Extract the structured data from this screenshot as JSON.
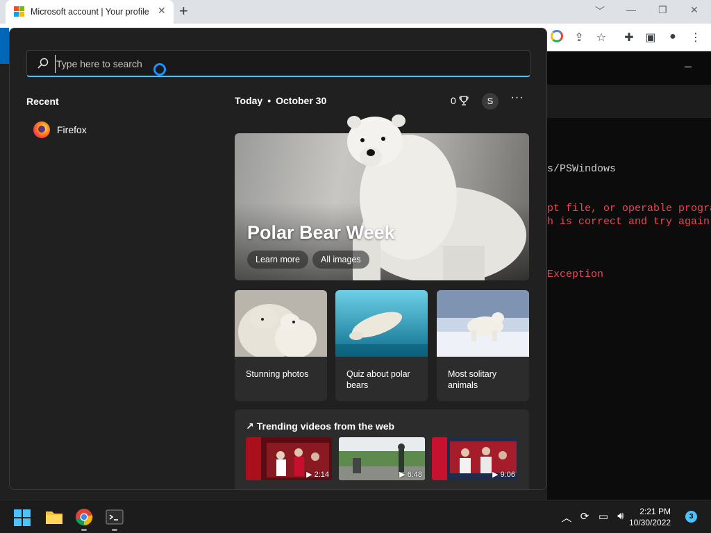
{
  "browser": {
    "tab_title": "Microsoft account | Your profile",
    "tab_close": "✕",
    "new_tab": "+"
  },
  "terminal": {
    "lines": [
      "s/PSWindows",
      "pt file, or operable progra",
      "h is correct and try again",
      "Exception"
    ]
  },
  "search": {
    "placeholder": "Type here to search",
    "value": ""
  },
  "recent": {
    "title": "Recent",
    "items": [
      {
        "label": "Firefox",
        "icon": "firefox-icon"
      }
    ]
  },
  "feed": {
    "today": "Today",
    "date": "October 30",
    "rewards_points": "0",
    "avatar_initial": "S",
    "more": "···",
    "hero": {
      "title": "Polar Bear Week",
      "buttons": [
        "Learn more",
        "All images"
      ]
    },
    "cards": [
      {
        "label": "Stunning photos"
      },
      {
        "label": "Quiz about polar bears"
      },
      {
        "label": "Most solitary animals"
      }
    ],
    "trending": {
      "title": "Trending videos from the web",
      "videos": [
        {
          "duration": "2:14"
        },
        {
          "duration": "6:48"
        },
        {
          "duration": "9:06"
        }
      ]
    }
  },
  "taskbar": {
    "time": "2:21 PM",
    "date": "10/30/2022",
    "notifications": "3"
  },
  "colors": {
    "accent": "#4cc2ff",
    "panel_bg": "#202020",
    "card_bg": "#2c2c2c",
    "error_text": "#e74856"
  }
}
